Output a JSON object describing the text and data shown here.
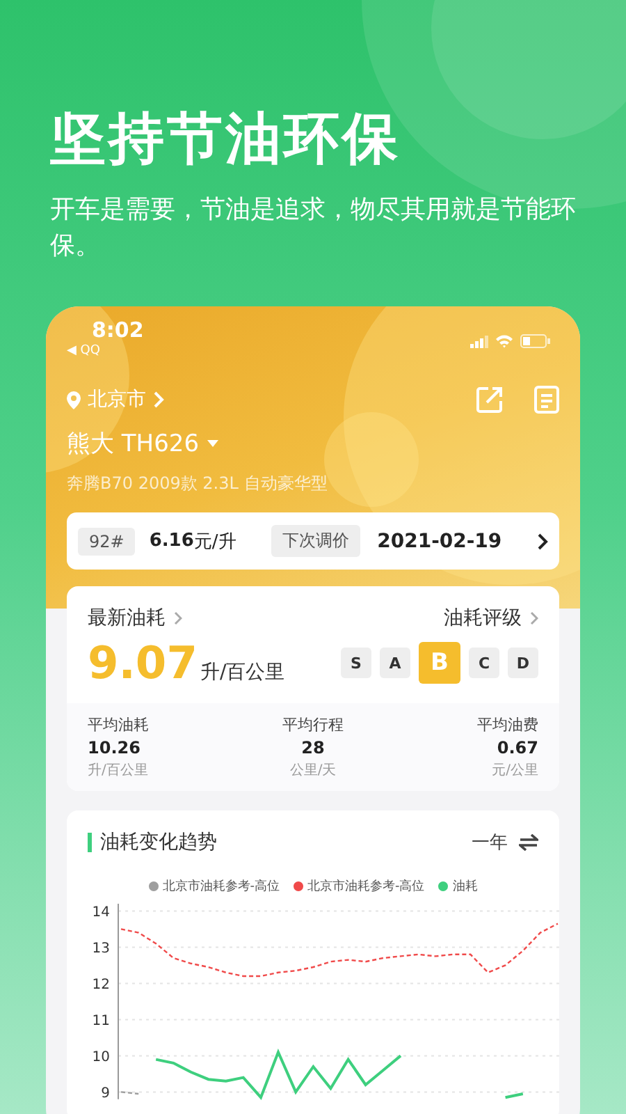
{
  "promo": {
    "title": "坚持节油环保",
    "subtitle": "开车是需要，节油是追求，物尽其用就是节能环保。"
  },
  "status_bar": {
    "time": "8:02",
    "back_app": "◀ QQ"
  },
  "header": {
    "city": "北京市",
    "car_name": "熊大 TH626",
    "car_model": "奔腾B70 2009款 2.3L 自动豪华型"
  },
  "price_bar": {
    "grade": "92#",
    "price": "6.16",
    "price_unit": "元/升",
    "next_label": "下次调价",
    "next_date": "2021-02-19"
  },
  "consumption": {
    "latest_label": "最新油耗",
    "rating_label": "油耗评级",
    "value": "9.07",
    "unit": "升/百公里",
    "grades": [
      {
        "label": "S",
        "selected": false
      },
      {
        "label": "A",
        "selected": false
      },
      {
        "label": "B",
        "selected": true
      },
      {
        "label": "C",
        "selected": false
      },
      {
        "label": "D",
        "selected": false
      }
    ],
    "stats": [
      {
        "label": "平均油耗",
        "value": "10.26",
        "unit": "升/百公里"
      },
      {
        "label": "平均行程",
        "value": "28",
        "unit": "公里/天"
      },
      {
        "label": "平均油费",
        "value": "0.67",
        "unit": "元/公里"
      }
    ]
  },
  "trend": {
    "title": "油耗变化趋势",
    "period": "一年",
    "chart_data": {
      "type": "line",
      "grid": true,
      "ylim": [
        8.8,
        14.2
      ],
      "yticks": [
        9,
        10,
        11,
        12,
        13,
        14
      ],
      "series": [
        {
          "name": "北京市油耗参考-高位",
          "color": "#9e9e9e",
          "line_style": "dashed",
          "values": [
            9.0,
            8.95,
            null,
            null,
            null,
            null,
            null,
            null,
            null,
            null,
            null,
            null,
            null,
            null,
            null,
            null,
            null,
            null,
            null,
            null,
            null,
            null,
            null,
            null,
            null,
            null
          ]
        },
        {
          "name": "北京市油耗参考-高位",
          "color": "#f04a4a",
          "line_style": "dashed",
          "values": [
            13.5,
            13.4,
            13.1,
            12.7,
            12.55,
            12.45,
            12.3,
            12.2,
            12.2,
            12.3,
            12.35,
            12.45,
            12.6,
            12.65,
            12.6,
            12.7,
            12.75,
            12.8,
            12.75,
            12.8,
            12.8,
            12.3,
            12.5,
            12.9,
            13.4,
            13.65
          ]
        },
        {
          "name": "油耗",
          "color": "#3ecf7e",
          "line_style": "solid",
          "values": [
            null,
            null,
            9.9,
            9.8,
            9.55,
            9.35,
            9.3,
            9.4,
            8.85,
            10.1,
            9.0,
            9.7,
            9.1,
            9.9,
            9.2,
            9.6,
            10.0,
            null,
            null,
            null,
            null,
            null,
            8.85,
            8.95,
            null,
            null
          ]
        }
      ]
    }
  }
}
